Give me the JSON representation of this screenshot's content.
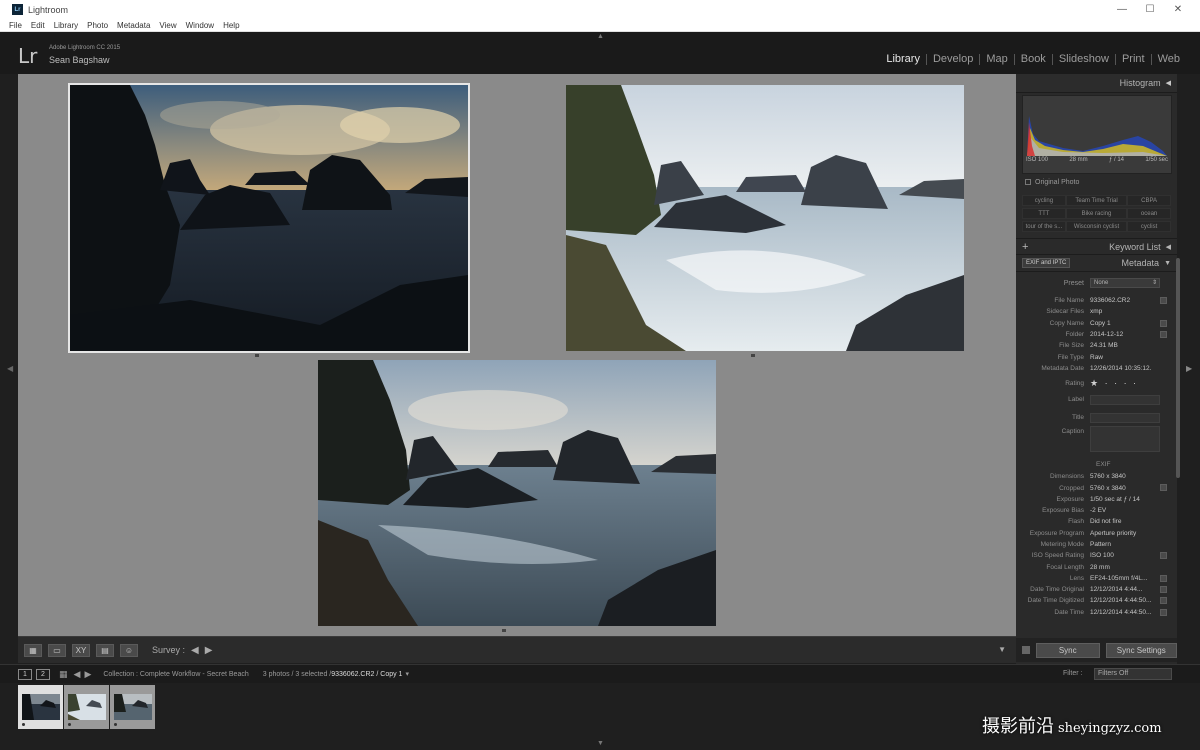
{
  "window": {
    "icon_text": "Lr",
    "title": "Lightroom",
    "controls": [
      "—",
      "☐",
      "✕"
    ]
  },
  "menu": [
    "File",
    "Edit",
    "Library",
    "Photo",
    "Metadata",
    "View",
    "Window",
    "Help"
  ],
  "identity": {
    "logo": "Lr",
    "product": "Adobe Lightroom CC 2015",
    "user": "Sean Bagshaw"
  },
  "modules": [
    "Library",
    "Develop",
    "Map",
    "Book",
    "Slideshow",
    "Print",
    "Web"
  ],
  "active_module": "Library",
  "toolbar": {
    "view_icons": [
      "grid-icon",
      "loupe-icon",
      "compare-icon",
      "survey-icon",
      "people-icon"
    ],
    "view_glyphs": [
      "▦",
      "▭",
      "XY",
      "▤",
      "☺"
    ],
    "survey_label": "Survey :",
    "prev_arrow": "◀",
    "next_arrow": "▶",
    "options_caret": "▼"
  },
  "photos": [
    {
      "label": "Photo 1 - dark sunset sea stacks",
      "tone": "dark",
      "selected": true
    },
    {
      "label": "Photo 2 - bright sea stacks",
      "tone": "bright",
      "selected": false
    },
    {
      "label": "Photo 3 - balanced sea stacks",
      "tone": "mid",
      "selected": false
    }
  ],
  "histogram": {
    "title": "Histogram",
    "iso": "ISO 100",
    "focal": "28 mm",
    "aperture": "ƒ / 14",
    "shutter": "1/50 sec",
    "original_photo": "Original Photo"
  },
  "keywords": {
    "suggestions": [
      "cycling",
      "Team Time Trial",
      "CBPA",
      "TTT",
      "Bike racing",
      "ocean",
      "tour of the s...",
      "Wisconsin cyclist",
      "cyclist"
    ],
    "title": "Keyword List",
    "add": "+"
  },
  "metadata": {
    "title": "Metadata",
    "set_select": "EXIF and IPTC",
    "preset_label": "Preset",
    "preset_value": "None",
    "rows": [
      {
        "k": "File Name",
        "v": "9336062.CR2",
        "btn": true
      },
      {
        "k": "Sidecar Files",
        "v": "xmp",
        "btn": false
      },
      {
        "k": "Copy Name",
        "v": "Copy 1",
        "btn": true
      },
      {
        "k": "Folder",
        "v": "2014-12-12",
        "btn": true
      },
      {
        "k": "File Size",
        "v": "24.31 MB",
        "btn": false
      },
      {
        "k": "File Type",
        "v": "Raw",
        "btn": false
      },
      {
        "k": "Metadata Date",
        "v": "12/26/2014 10:35:12...",
        "btn": false
      }
    ],
    "rating_label": "Rating",
    "rating_value": "★ · · · ·",
    "label_label": "Label",
    "title_label": "Title",
    "caption_label": "Caption",
    "exif_label": "EXIF",
    "exif_rows": [
      {
        "k": "Dimensions",
        "v": "5760 x 3840",
        "btn": false
      },
      {
        "k": "Cropped",
        "v": "5760 x 3840",
        "btn": true
      },
      {
        "k": "Exposure",
        "v": "1/50 sec at ƒ / 14",
        "btn": false
      },
      {
        "k": "Exposure Bias",
        "v": "-2 EV",
        "btn": false
      },
      {
        "k": "Flash",
        "v": "Did not fire",
        "btn": false
      },
      {
        "k": "Exposure Program",
        "v": "Aperture priority",
        "btn": false
      },
      {
        "k": "Metering Mode",
        "v": "Pattern",
        "btn": false
      },
      {
        "k": "ISO Speed Rating",
        "v": "ISO 100",
        "btn": true
      },
      {
        "k": "Focal Length",
        "v": "28 mm",
        "btn": false
      },
      {
        "k": "Lens",
        "v": "EF24-105mm f/4L...",
        "btn": true
      },
      {
        "k": "Date Time Original",
        "v": "12/12/2014 4:44...",
        "btn": true
      },
      {
        "k": "Date Time Digitized",
        "v": "12/12/2014 4:44:50...",
        "btn": true
      },
      {
        "k": "Date Time",
        "v": "12/12/2014 4:44:50...",
        "btn": true
      }
    ]
  },
  "sync": {
    "sync": "Sync",
    "sync_settings": "Sync Settings"
  },
  "filmbar": {
    "screen1": "1",
    "screen2": "2",
    "collection": "Collection : Complete Workflow - Secret Beach",
    "count_prefix": "3 photos / 3 selected /",
    "current_file": "9336062.CR2 / Copy 1",
    "dropdown": "▾",
    "filter_label": "Filter :",
    "filter_value": "Filters Off"
  },
  "watermark": {
    "cn": "摄影前沿",
    "site": "sheyingzyz.com"
  }
}
